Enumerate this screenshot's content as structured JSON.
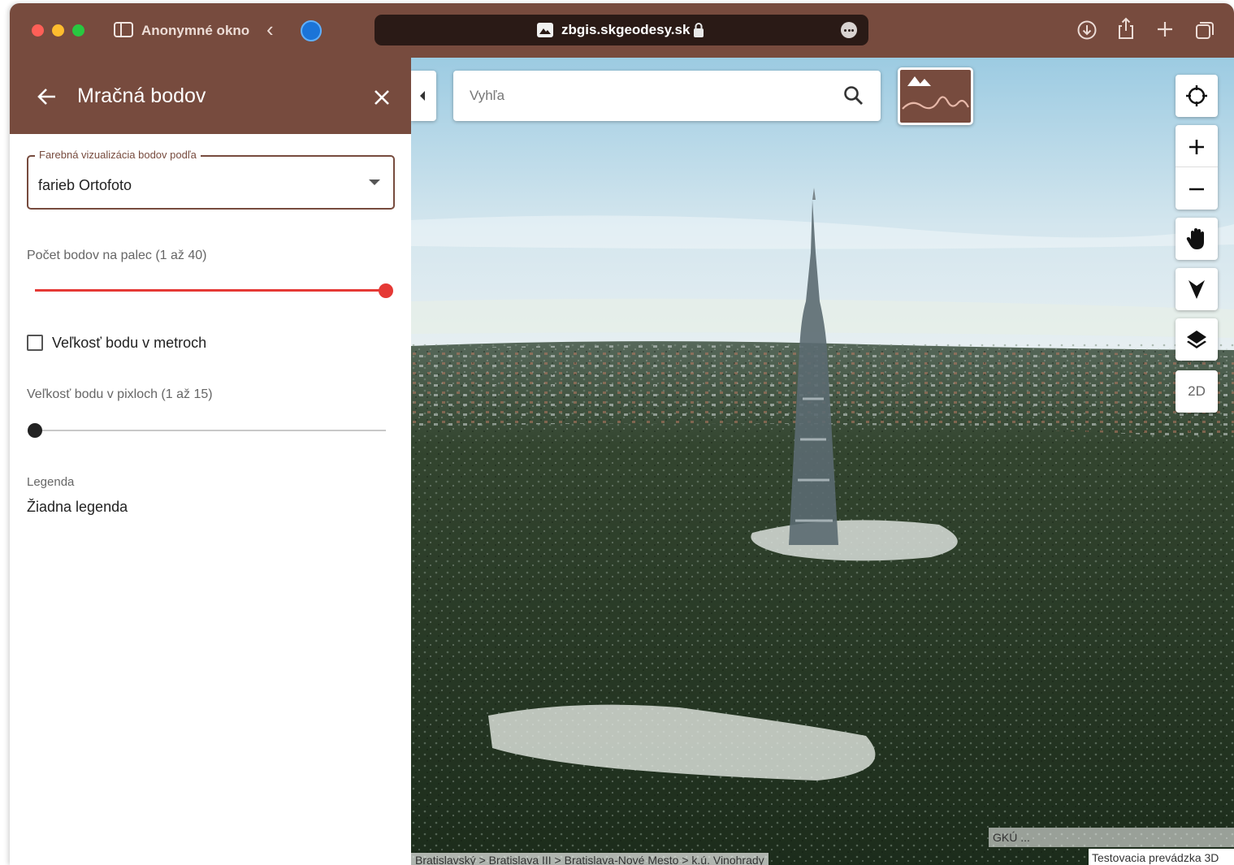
{
  "browser": {
    "private_window_label": "Anonymné okno",
    "address": "zbgis.skgeodesy.sk",
    "icons": {
      "sidebar": "sidebar-icon",
      "back": "chevron-left-icon",
      "extension": "extension-icon",
      "favicon": "mountain-favicon-icon",
      "lock": "lock-icon",
      "more": "more-icon",
      "download": "download-icon",
      "share": "share-icon",
      "new_tab": "plus-icon",
      "tabs": "tabs-overview-icon"
    }
  },
  "panel": {
    "title": "Mračná bodov",
    "icons": {
      "back": "arrow-left-icon",
      "close": "close-icon"
    },
    "color_viz": {
      "label": "Farebná vizualizácia bodov podľa",
      "value": "farieb Ortofoto"
    },
    "points_per_inch": {
      "label": "Počet bodov na palec (1 až 40)",
      "min": 1,
      "max": 40,
      "value": 40
    },
    "size_in_meters": {
      "label": "Veľkosť bodu v metroch",
      "checked": false
    },
    "size_in_pixels": {
      "label": "Veľkosť bodu v pixloch (1 až 15)",
      "min": 1,
      "max": 15,
      "value": 1
    },
    "legend": {
      "label": "Legenda",
      "value": "Žiadna legenda"
    }
  },
  "map": {
    "search_placeholder": "Vyhľa",
    "toolbar": {
      "mode_2d_label": "2D"
    },
    "icons": {
      "collapse": "caret-left-icon",
      "search": "search-icon",
      "basemap": "terrain-basemap-icon",
      "locate": "crosshair-icon",
      "zoom_in": "plus-icon",
      "zoom_out": "minus-icon",
      "pan": "hand-icon",
      "compass": "navigation-arrow-icon",
      "layers": "layers-icon"
    },
    "attribution": "GKÚ ...",
    "breadcrumb": "Bratislavský > Bratislava III > Bratislava-Nové Mesto > k.ú. Vinohrady",
    "status": "Testovacia prevádzka 3D"
  },
  "colors": {
    "brand": "#774b3e",
    "slider_active": "#e53935",
    "slider_inactive": "#222222"
  }
}
